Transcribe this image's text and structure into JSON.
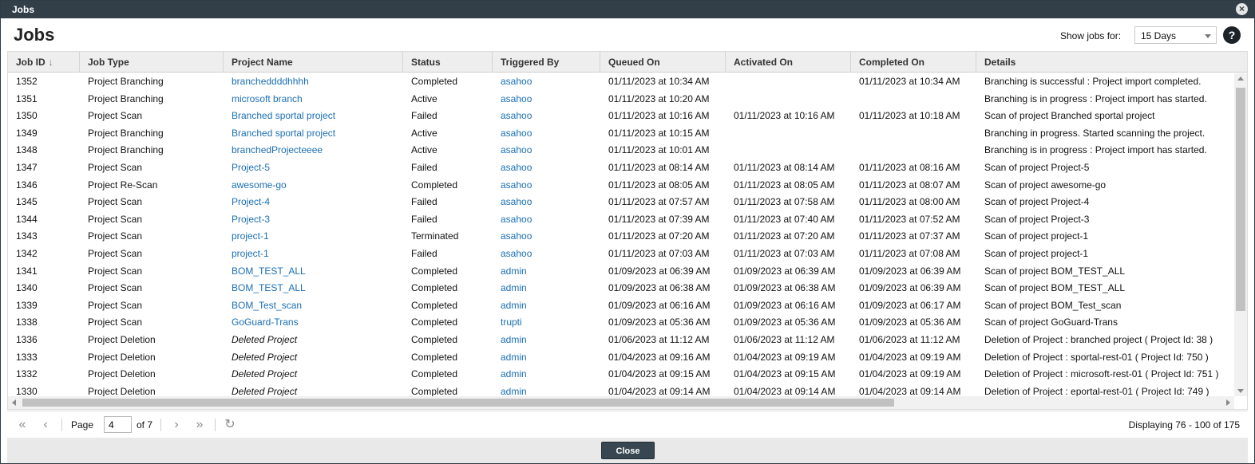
{
  "window": {
    "title": "Jobs",
    "close_icon": "×"
  },
  "header": {
    "title": "Jobs",
    "show_jobs_label": "Show jobs for:",
    "show_jobs_value": "15 Days",
    "help_label": "?"
  },
  "columns": [
    {
      "label": "Job ID",
      "sort": "↓"
    },
    {
      "label": "Job Type"
    },
    {
      "label": "Project Name"
    },
    {
      "label": "Status"
    },
    {
      "label": "Triggered By"
    },
    {
      "label": "Queued On"
    },
    {
      "label": "Activated On"
    },
    {
      "label": "Completed On"
    },
    {
      "label": "Details"
    }
  ],
  "rows": [
    {
      "id": "1352",
      "type": "Project Branching",
      "project": "brancheddddhhhh",
      "status": "Completed",
      "by": "asahoo",
      "queued": "01/11/2023 at 10:34 AM",
      "activated": "",
      "completed": "01/11/2023 at 10:34 AM",
      "details": "Branching is successful : Project import completed."
    },
    {
      "id": "1351",
      "type": "Project Branching",
      "project": "microsoft branch",
      "status": "Active",
      "by": "asahoo",
      "queued": "01/11/2023 at 10:20 AM",
      "activated": "",
      "completed": "",
      "details": "Branching is in progress : Project import has started."
    },
    {
      "id": "1350",
      "type": "Project Scan",
      "project": "Branched sportal project",
      "status": "Failed",
      "by": "asahoo",
      "queued": "01/11/2023 at 10:16 AM",
      "activated": "01/11/2023 at 10:16 AM",
      "completed": "01/11/2023 at 10:18 AM",
      "details": "Scan of project Branched sportal project"
    },
    {
      "id": "1349",
      "type": "Project Branching",
      "project": "Branched sportal project",
      "status": "Active",
      "by": "asahoo",
      "queued": "01/11/2023 at 10:15 AM",
      "activated": "",
      "completed": "",
      "details": "Branching in progress. Started scanning the project."
    },
    {
      "id": "1348",
      "type": "Project Branching",
      "project": "branchedProjecteeee",
      "status": "Active",
      "by": "asahoo",
      "queued": "01/11/2023 at 10:01 AM",
      "activated": "",
      "completed": "",
      "details": "Branching is in progress : Project import has started."
    },
    {
      "id": "1347",
      "type": "Project Scan",
      "project": "Project-5",
      "status": "Failed",
      "by": "asahoo",
      "queued": "01/11/2023 at 08:14 AM",
      "activated": "01/11/2023 at 08:14 AM",
      "completed": "01/11/2023 at 08:16 AM",
      "details": "Scan of project Project-5"
    },
    {
      "id": "1346",
      "type": "Project Re-Scan",
      "project": "awesome-go",
      "status": "Completed",
      "by": "asahoo",
      "queued": "01/11/2023 at 08:05 AM",
      "activated": "01/11/2023 at 08:05 AM",
      "completed": "01/11/2023 at 08:07 AM",
      "details": "Scan of project awesome-go"
    },
    {
      "id": "1345",
      "type": "Project Scan",
      "project": "Project-4",
      "status": "Failed",
      "by": "asahoo",
      "queued": "01/11/2023 at 07:57 AM",
      "activated": "01/11/2023 at 07:58 AM",
      "completed": "01/11/2023 at 08:00 AM",
      "details": "Scan of project Project-4"
    },
    {
      "id": "1344",
      "type": "Project Scan",
      "project": "Project-3",
      "status": "Failed",
      "by": "asahoo",
      "queued": "01/11/2023 at 07:39 AM",
      "activated": "01/11/2023 at 07:40 AM",
      "completed": "01/11/2023 at 07:52 AM",
      "details": "Scan of project Project-3"
    },
    {
      "id": "1343",
      "type": "Project Scan",
      "project": "project-1",
      "status": "Terminated",
      "by": "asahoo",
      "queued": "01/11/2023 at 07:20 AM",
      "activated": "01/11/2023 at 07:20 AM",
      "completed": "01/11/2023 at 07:37 AM",
      "details": "Scan of project project-1"
    },
    {
      "id": "1342",
      "type": "Project Scan",
      "project": "project-1",
      "status": "Failed",
      "by": "asahoo",
      "queued": "01/11/2023 at 07:03 AM",
      "activated": "01/11/2023 at 07:03 AM",
      "completed": "01/11/2023 at 07:08 AM",
      "details": "Scan of project project-1"
    },
    {
      "id": "1341",
      "type": "Project Scan",
      "project": "BOM_TEST_ALL",
      "status": "Completed",
      "by": "admin",
      "queued": "01/09/2023 at 06:39 AM",
      "activated": "01/09/2023 at 06:39 AM",
      "completed": "01/09/2023 at 06:39 AM",
      "details": "Scan of project BOM_TEST_ALL"
    },
    {
      "id": "1340",
      "type": "Project Scan",
      "project": "BOM_TEST_ALL",
      "status": "Completed",
      "by": "admin",
      "queued": "01/09/2023 at 06:38 AM",
      "activated": "01/09/2023 at 06:38 AM",
      "completed": "01/09/2023 at 06:39 AM",
      "details": "Scan of project BOM_TEST_ALL"
    },
    {
      "id": "1339",
      "type": "Project Scan",
      "project": "BOM_Test_scan",
      "status": "Completed",
      "by": "admin",
      "queued": "01/09/2023 at 06:16 AM",
      "activated": "01/09/2023 at 06:16 AM",
      "completed": "01/09/2023 at 06:17 AM",
      "details": "Scan of project BOM_Test_scan"
    },
    {
      "id": "1338",
      "type": "Project Scan",
      "project": "GoGuard-Trans",
      "status": "Completed",
      "by": "trupti",
      "queued": "01/09/2023 at 05:36 AM",
      "activated": "01/09/2023 at 05:36 AM",
      "completed": "01/09/2023 at 05:36 AM",
      "details": "Scan of project GoGuard-Trans"
    },
    {
      "id": "1336",
      "type": "Project Deletion",
      "project": "Deleted Project",
      "deleted": true,
      "status": "Completed",
      "by": "admin",
      "queued": "01/06/2023 at 11:12 AM",
      "activated": "01/06/2023 at 11:12 AM",
      "completed": "01/06/2023 at 11:12 AM",
      "details": "Deletion of Project : branched project ( Project Id: 38 )"
    },
    {
      "id": "1333",
      "type": "Project Deletion",
      "project": "Deleted Project",
      "deleted": true,
      "status": "Completed",
      "by": "admin",
      "queued": "01/04/2023 at 09:16 AM",
      "activated": "01/04/2023 at 09:19 AM",
      "completed": "01/04/2023 at 09:19 AM",
      "details": "Deletion of Project : sportal-rest-01 ( Project Id: 750 )"
    },
    {
      "id": "1332",
      "type": "Project Deletion",
      "project": "Deleted Project",
      "deleted": true,
      "status": "Completed",
      "by": "admin",
      "queued": "01/04/2023 at 09:15 AM",
      "activated": "01/04/2023 at 09:15 AM",
      "completed": "01/04/2023 at 09:19 AM",
      "details": "Deletion of Project : microsoft-rest-01 ( Project Id: 751 )"
    },
    {
      "id": "1330",
      "type": "Project Deletion",
      "project": "Deleted Project",
      "deleted": true,
      "status": "Completed",
      "by": "admin",
      "queued": "01/04/2023 at 09:14 AM",
      "activated": "01/04/2023 at 09:14 AM",
      "completed": "01/04/2023 at 09:14 AM",
      "details": "Deletion of Project : eportal-rest-01 ( Project Id: 749 )"
    }
  ],
  "pager": {
    "first_icon": "«",
    "prev_icon": "‹",
    "page_label": "Page",
    "page_value": "4",
    "of_label": "of 7",
    "next_icon": "›",
    "last_icon": "»",
    "refresh_icon": "↻",
    "display_text": "Displaying 76 - 100 of 175"
  },
  "footer": {
    "close_label": "Close"
  },
  "colors": {
    "titlebar": "#323f49",
    "link": "#1a6fb5",
    "header_bg": "#eeeeee",
    "button": "#374650"
  }
}
